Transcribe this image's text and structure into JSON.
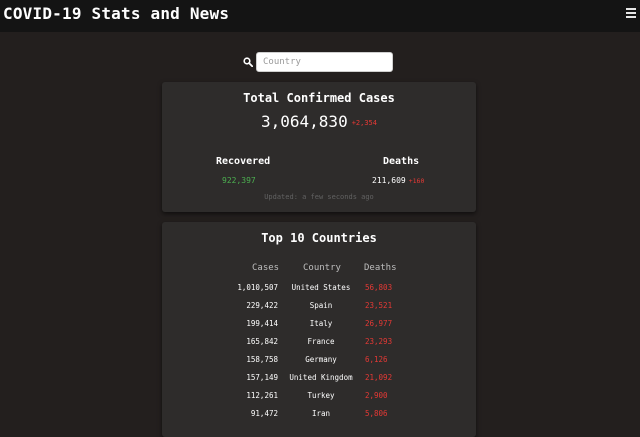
{
  "navbar": {
    "title": "COVID-19 Stats and News",
    "menu_icon": "hamburger-menu-icon"
  },
  "search": {
    "placeholder": "Country",
    "icon": "search-icon"
  },
  "summary": {
    "title": "Total Confirmed Cases",
    "total": "3,064,830",
    "total_delta": "+2,354",
    "recovered_label": "Recovered",
    "recovered_value": "922,397",
    "deaths_label": "Deaths",
    "deaths_value": "211,609",
    "deaths_delta": "+160",
    "updated": "Updated: a few seconds ago"
  },
  "top10": {
    "title": "Top 10 Countries",
    "headers": {
      "cases": "Cases",
      "country": "Country",
      "deaths": "Deaths"
    },
    "rows": [
      {
        "cases": "1,010,507",
        "country": "United States",
        "deaths": "56,803"
      },
      {
        "cases": "229,422",
        "country": "Spain",
        "deaths": "23,521"
      },
      {
        "cases": "199,414",
        "country": "Italy",
        "deaths": "26,977"
      },
      {
        "cases": "165,842",
        "country": "France",
        "deaths": "23,293"
      },
      {
        "cases": "158,758",
        "country": "Germany",
        "deaths": "6,126"
      },
      {
        "cases": "157,149",
        "country": "United Kingdom",
        "deaths": "21,092"
      },
      {
        "cases": "112,261",
        "country": "Turkey",
        "deaths": "2,900"
      },
      {
        "cases": "91,472",
        "country": "Iran",
        "deaths": "5,806"
      }
    ]
  },
  "colors": {
    "background": "#231f1e",
    "card": "#2e2c2b",
    "navbar": "#141414",
    "recovered": "#4caf50",
    "deaths": "#e53935"
  }
}
